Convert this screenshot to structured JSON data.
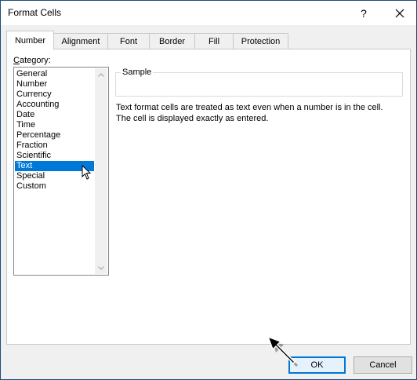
{
  "window": {
    "title": "Format Cells",
    "help_label": "?"
  },
  "tabs": [
    {
      "label": "Number",
      "active": true
    },
    {
      "label": "Alignment",
      "active": false
    },
    {
      "label": "Font",
      "active": false
    },
    {
      "label": "Border",
      "active": false
    },
    {
      "label": "Fill",
      "active": false
    },
    {
      "label": "Protection",
      "active": false
    }
  ],
  "category": {
    "label_prefix": "C",
    "label_rest": "ategory:",
    "items": [
      "General",
      "Number",
      "Currency",
      "Accounting",
      "Date",
      "Time",
      "Percentage",
      "Fraction",
      "Scientific",
      "Text",
      "Special",
      "Custom"
    ],
    "selected": "Text"
  },
  "sample": {
    "label": "Sample",
    "value": ""
  },
  "description": {
    "line1": "Text format cells are treated as text even when a number is in the cell.",
    "line2": "The cell is displayed exactly as entered."
  },
  "buttons": {
    "ok": "OK",
    "cancel": "Cancel"
  },
  "colors": {
    "selection": "#0078d7",
    "default_button_border": "#0078d7",
    "window_border": "#1e4b7a"
  },
  "icons": {
    "close": "close-icon",
    "scroll_up": "chevron-up-icon",
    "scroll_down": "chevron-down-icon",
    "mouse_cursor": "cursor-pointer-icon",
    "annotation_arrow": "arrow-pointer-icon"
  }
}
